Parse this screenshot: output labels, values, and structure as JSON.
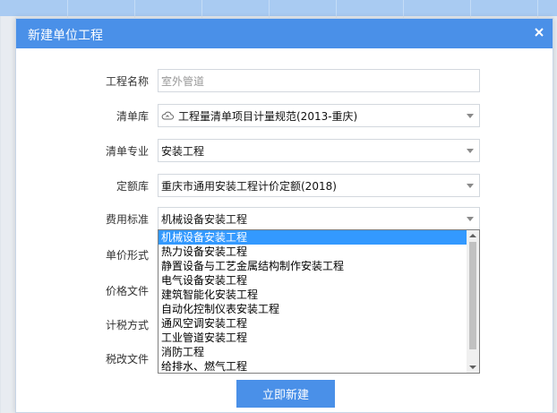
{
  "dialog": {
    "title": "新建单位工程",
    "fields": {
      "project_name": {
        "label": "工程名称",
        "value": "室外管道"
      },
      "bill_library": {
        "label": "清单库",
        "value": "工程量清单项目计量规范(2013-重庆)",
        "icon": "cloud-icon"
      },
      "bill_specialty": {
        "label": "清单专业",
        "value": "安装工程"
      },
      "quota_library": {
        "label": "定额库",
        "value": "重庆市通用安装工程计价定额(2018)"
      },
      "fee_standard": {
        "label": "费用标准",
        "value": "机械设备安装工程"
      },
      "unit_price_form": {
        "label": "单价形式"
      },
      "price_file": {
        "label": "价格文件"
      },
      "tax_method": {
        "label": "计税方式"
      },
      "tax_reform_file": {
        "label": "税改文件"
      }
    },
    "fee_standard_options": [
      "机械设备安装工程",
      "热力设备安装工程",
      "静置设备与工艺金属结构制作安装工程",
      "电气设备安装工程",
      "建筑智能化安装工程",
      "自动化控制仪表安装工程",
      "通风空调安装工程",
      "工业管道安装工程",
      "消防工程",
      "给排水、燃气工程"
    ],
    "selected_option_index": 0,
    "submit_label": "立即新建"
  },
  "colors": {
    "accent": "#4a90e8",
    "selected": "#3399ff"
  }
}
